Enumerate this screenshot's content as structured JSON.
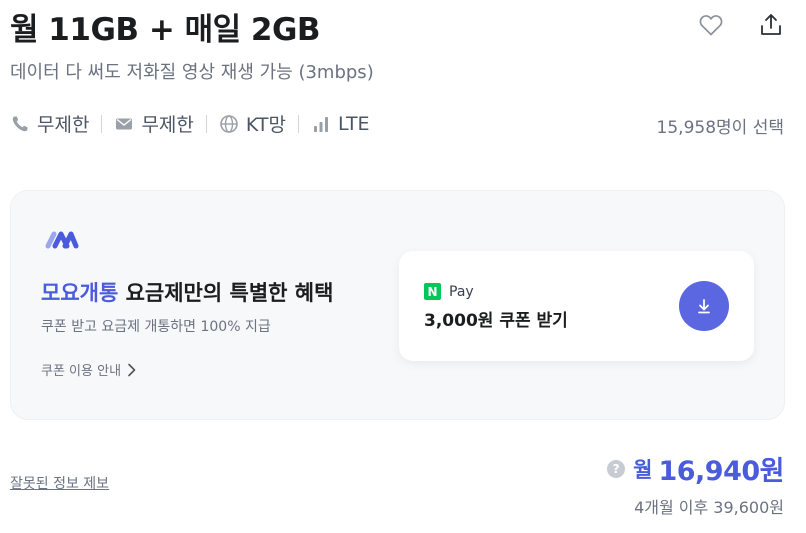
{
  "plan": {
    "title": "월 11GB + 매일 2GB",
    "subtitle": "데이터 다 써도 저화질 영상 재생 가능 (3mbps)"
  },
  "actions": {
    "like_icon": "heart-icon",
    "share_icon": "share-icon"
  },
  "specs": [
    {
      "icon": "phone-icon",
      "label": "무제한"
    },
    {
      "icon": "mail-icon",
      "label": "무제한"
    },
    {
      "icon": "globe-icon",
      "label": "KT망"
    },
    {
      "icon": "signal-icon",
      "label": "LTE"
    }
  ],
  "selected_count": "15,958명이 선택",
  "benefit": {
    "brand": "모요개통",
    "title_rest": " 요금제만의 특별한 혜택",
    "description": "쿠폰 받고 요금제 개통하면 100% 지급",
    "guide_link": "쿠폰 이용 안내",
    "coupon": {
      "provider_logo": "N",
      "provider": "Pay",
      "amount": "3,000원 쿠폰 받기"
    }
  },
  "footer": {
    "report_link": "잘못된 정보 제보",
    "help_icon": "?",
    "price_prefix": "월",
    "price": "16,940원",
    "after_price": "4개월 이후 39,600원"
  },
  "colors": {
    "accent": "#4a5bdc",
    "button": "#5a67e0",
    "npay_green": "#03c75a",
    "card_bg": "#f7f8fa"
  }
}
